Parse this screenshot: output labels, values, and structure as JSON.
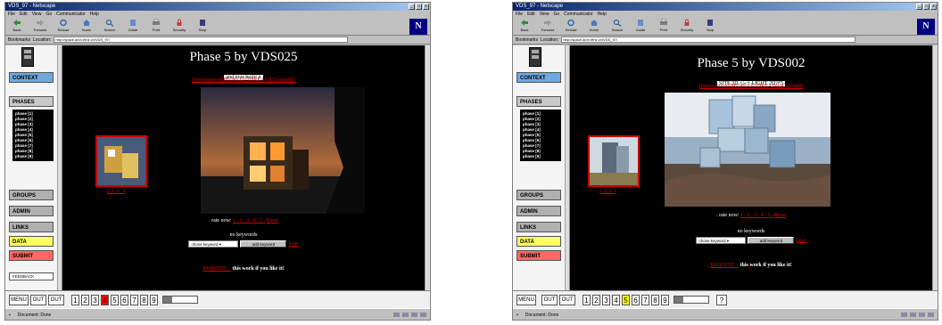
{
  "window1": {
    "title": "VDS_97 - Netscape",
    "menu": [
      "File",
      "Edit",
      "View",
      "Go",
      "Communicator",
      "Help"
    ],
    "toolbar": [
      "Back",
      "Forward",
      "Reload",
      "Home",
      "Search",
      "Guide",
      "Print",
      "Security",
      "Stop"
    ],
    "bookmarks_label": "Bookmarks",
    "location_label": "Location:",
    "url": "http://space.arch.ethz.ch/VDS_97/",
    "nav": {
      "context": "CONTEXT",
      "phases": "PHASES",
      "groups": "GROUPS",
      "admin": "ADMIN",
      "links": "LINKS",
      "data": "DATA",
      "submit": "SUBMIT",
      "feedback": "FEEDBACK"
    },
    "phases": [
      "phase [1]",
      "phase [2]",
      "phase [3]",
      "phase [4]",
      "phase [5]",
      "phase [6]",
      "phase [7]",
      "phase [8]",
      "phase [9]"
    ],
    "main": {
      "title": "Phase 5 by VDS025",
      "subtitle": "and now build it",
      "links": "[presentation][PEOPLE][THREAD][3D-model]",
      "thumb_caption": "p_4_25_3",
      "rate_label": ". rate now:",
      "rate_nums": "1 . 2 . 3 . 4 . 5 .",
      "rate_reset": "Reset",
      "no_keywords": "no keywords",
      "keyword_select": "chose keyword",
      "add_keyword": "add keyword",
      "keyword_reset": "Reset",
      "request_link": "REQUEST >",
      "request_text": "this work if you like it!"
    },
    "bottom": {
      "menu": "MENU",
      "out1": "OUT",
      "out2": "OUT",
      "numbers": [
        "1",
        "2",
        "3",
        "4",
        "5",
        "6",
        "7",
        "8",
        "9"
      ],
      "highlight_index": 3,
      "highlight_color": "#ff0000"
    },
    "status": "Document: Done"
  },
  "window2": {
    "title": "VDS_97 - Netscape",
    "menu": [
      "File",
      "Edit",
      "View",
      "Go",
      "Communicator",
      "Help"
    ],
    "toolbar": [
      "Back",
      "Forward",
      "Reload",
      "Home",
      "Search",
      "Guide",
      "Print",
      "Security",
      "Stop"
    ],
    "bookmarks_label": "Bookmarks",
    "location_label": "Location:",
    "url": "http://space.arch.ethz.ch/VDS_97/",
    "nav": {
      "context": "CONTEXT",
      "phases": "PHASES",
      "groups": "GROUPS",
      "admin": "ADMIN",
      "links": "LINKS",
      "data": "DATA",
      "submit": "SUBMIT",
      "feedback": "FEEDBACK"
    },
    "phases": [
      "phase [1]",
      "phase [2]",
      "phase [3]",
      "phase [4]",
      "phase [5]",
      "phase [6]",
      "phase [7]",
      "phase [8]",
      "phase [9]"
    ],
    "main": {
      "title": "Phase 5 by VDS002",
      "subtitle": "SITE 3D +/-/+ LIGHT 2D?*5",
      "links": "[presentation][PEOPLE][THREAD][3D-model]",
      "thumb_caption": "p_4_2_3",
      "rate_label": ". rate now:",
      "rate_nums": "1 . 2 . 3 . 4 . 5 .",
      "rate_reset": "Reset",
      "no_keywords": "no keywords",
      "keyword_select": "chose keyword",
      "add_keyword": "add keyword",
      "keyword_reset": "Reset",
      "request_link": "REQUEST >",
      "request_text": "this work if you like it!"
    },
    "bottom": {
      "menu": "MENU",
      "out1": "OUT",
      "out2": "OUT",
      "numbers": [
        "1",
        "2",
        "3",
        "4",
        "5",
        "6",
        "7",
        "8",
        "9"
      ],
      "highlight_index": 4,
      "highlight_color": "#ffff00",
      "help": "?"
    },
    "status": "Document: Done"
  },
  "colors": {
    "context": "#6fa8dc",
    "phases_bg": "#000000",
    "groups": "#b0b0b0",
    "admin": "#b0b0b0",
    "links": "#b0b0b0",
    "data": "#ffff66",
    "submit": "#ff6666",
    "link_red": "#dd0000"
  }
}
